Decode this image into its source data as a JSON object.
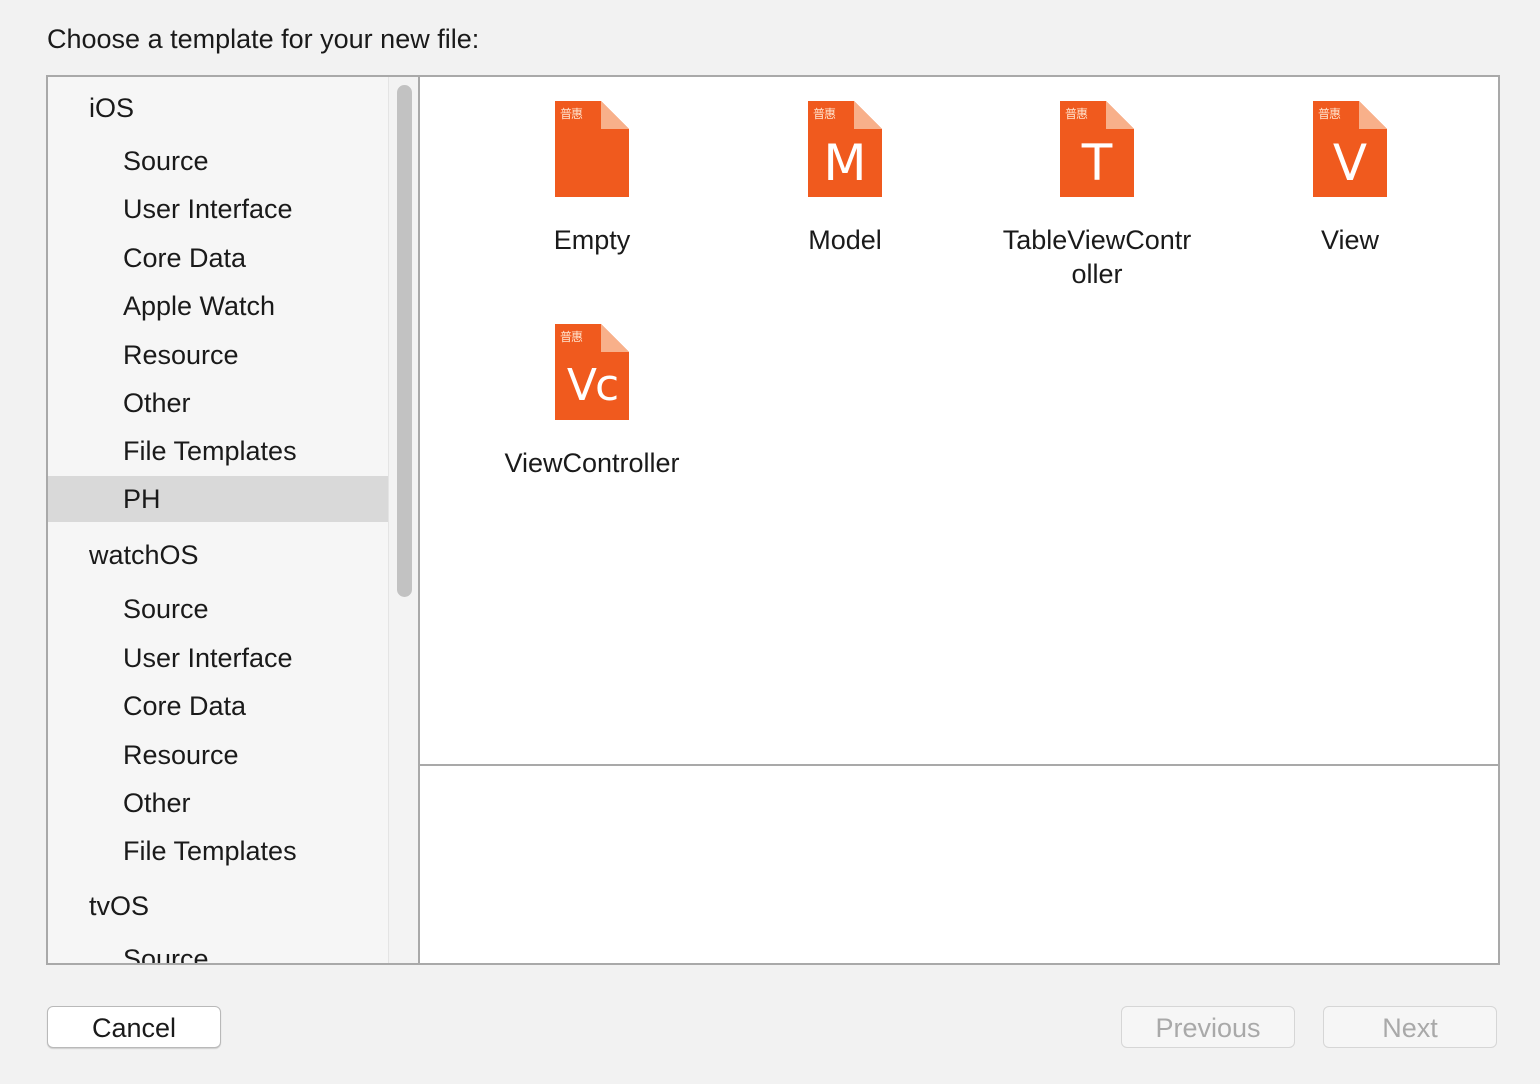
{
  "dialog": {
    "title": "Choose a template for your new file:"
  },
  "sidebar": {
    "rows": [
      {
        "type": "header",
        "label": "iOS"
      },
      {
        "type": "item",
        "label": "Source"
      },
      {
        "type": "item",
        "label": "User Interface"
      },
      {
        "type": "item",
        "label": "Core Data"
      },
      {
        "type": "item",
        "label": "Apple Watch"
      },
      {
        "type": "item",
        "label": "Resource"
      },
      {
        "type": "item",
        "label": "Other"
      },
      {
        "type": "item",
        "label": "File Templates"
      },
      {
        "type": "item",
        "label": "PH",
        "selected": true
      },
      {
        "type": "header",
        "label": "watchOS"
      },
      {
        "type": "item",
        "label": "Source"
      },
      {
        "type": "item",
        "label": "User Interface"
      },
      {
        "type": "item",
        "label": "Core Data"
      },
      {
        "type": "item",
        "label": "Resource"
      },
      {
        "type": "item",
        "label": "Other"
      },
      {
        "type": "item",
        "label": "File Templates"
      },
      {
        "type": "header",
        "label": "tvOS"
      },
      {
        "type": "item",
        "label": "Source"
      }
    ]
  },
  "templates": [
    {
      "label": "Empty",
      "icon_badge": "普惠",
      "icon_glyph": "",
      "icon": "empty-file-icon"
    },
    {
      "label": "Model",
      "icon_badge": "普惠",
      "icon_glyph": "M",
      "icon": "model-file-icon"
    },
    {
      "label": "TableViewContr\noller",
      "icon_badge": "普惠",
      "icon_glyph": "T",
      "icon": "tableviewcontroller-file-icon"
    },
    {
      "label": "View",
      "icon_badge": "普惠",
      "icon_glyph": "V",
      "icon": "view-file-icon"
    },
    {
      "label": "ViewController",
      "icon_badge": "普惠",
      "icon_glyph": "Vc",
      "icon": "viewcontroller-file-icon"
    }
  ],
  "buttons": {
    "cancel": "Cancel",
    "previous": "Previous",
    "next": "Next"
  },
  "colors": {
    "icon_orange": "#f05a1e",
    "icon_orange_dark": "#d9471a",
    "selection": "#d9d9d9"
  }
}
